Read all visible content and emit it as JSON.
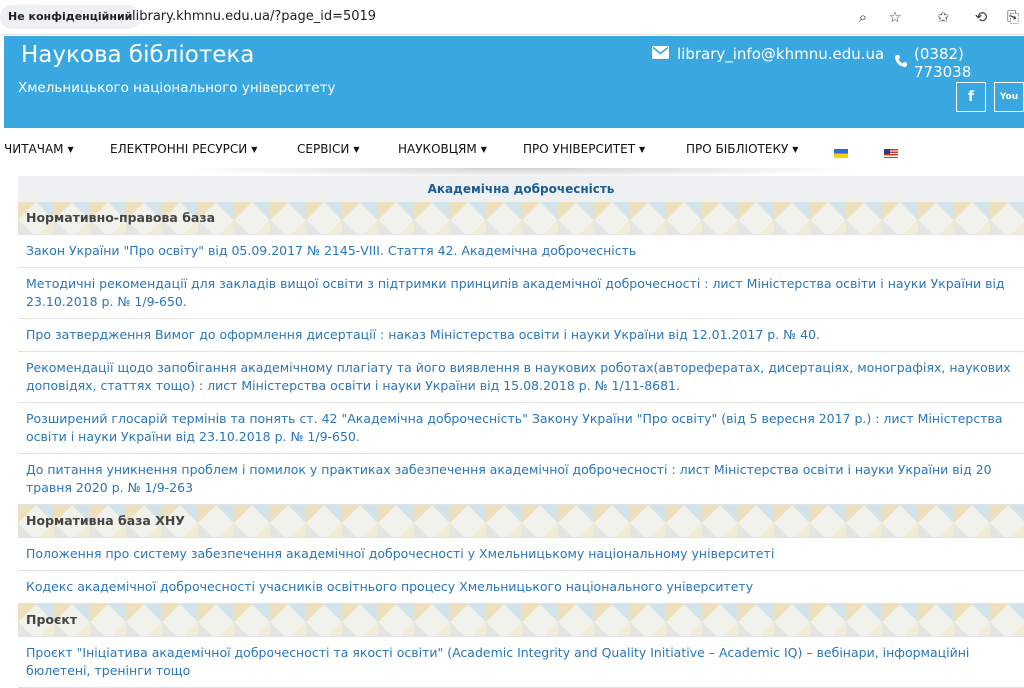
{
  "browser": {
    "security_label": "Не конфіденційний",
    "url": "library.khmnu.edu.ua/?page_id=5019"
  },
  "header": {
    "title": "Наукова бібліотека",
    "subtitle": "Хмельницького національного університету",
    "email": "library_info@khmnu.edu.ua",
    "phone": "(0382) 773038",
    "facebook_label": "f",
    "youtube_label": "You"
  },
  "nav": {
    "items": [
      {
        "label": "ЧИТАЧАМ"
      },
      {
        "label": "ЕЛЕКТРОННІ РЕСУРСИ"
      },
      {
        "label": "СЕРВІСИ"
      },
      {
        "label": "НАУКОВЦЯМ"
      },
      {
        "label": "ПРО УНІВЕРСИТЕТ"
      },
      {
        "label": "ПРО БІБЛІОТЕКУ"
      }
    ]
  },
  "table": {
    "title": "Академічна доброчесність",
    "sections": [
      {
        "heading": "Нормативно-правова база",
        "items": [
          "Закон України \"Про освіту\" від 05.09.2017 № 2145-VIII. Стаття 42. Академічна доброчесність",
          "Методичні рекомендації для закладів вищої освіти з підтримки принципів академічної доброчесності : лист Міністерства освіти і науки України від 23.10.2018 р. № 1/9-650.",
          "Про затвердження Вимог до оформлення дисертації : наказ Міністерства освіти і науки України від 12.01.2017 р. № 40.",
          "Рекомендації щодо запобігання академічному плагіату та його виявлення в наукових роботах(авторефератах, дисертаціях, монографіях, наукових доповідях, статтях тощо) : лист Міністерства освіти і науки України від 15.08.2018 р. № 1/11-8681.",
          "Розширений глосарій термінів та понять ст. 42 \"Академічна доброчесність\" Закону України \"Про освіту\" (від 5 вересня 2017 р.) : лист Міністерства освіти і науки України від 23.10.2018 р. № 1/9-650.",
          "До питання уникнення проблем і помилок у практиках забезпечення академічної доброчесності : лист Міністерства освіти і науки України від 20 травня 2020 р. № 1/9-263"
        ]
      },
      {
        "heading": "Нормативна база ХНУ",
        "items": [
          "Положення про систему забезпечення академічної доброчесності у Хмельницькому національному університеті",
          "Кодекс академічної доброчесності учасників освітнього процесу Хмельницького національного університету"
        ]
      },
      {
        "heading": "Проєкт",
        "items": [
          "Проєкт \"Ініціатива академічної доброчесності та якості освіти\" (Academic Integrity and Quality Initiative – Academic IQ) – вебінари, інформаційні бюлетені, тренінги тощо"
        ]
      }
    ]
  }
}
